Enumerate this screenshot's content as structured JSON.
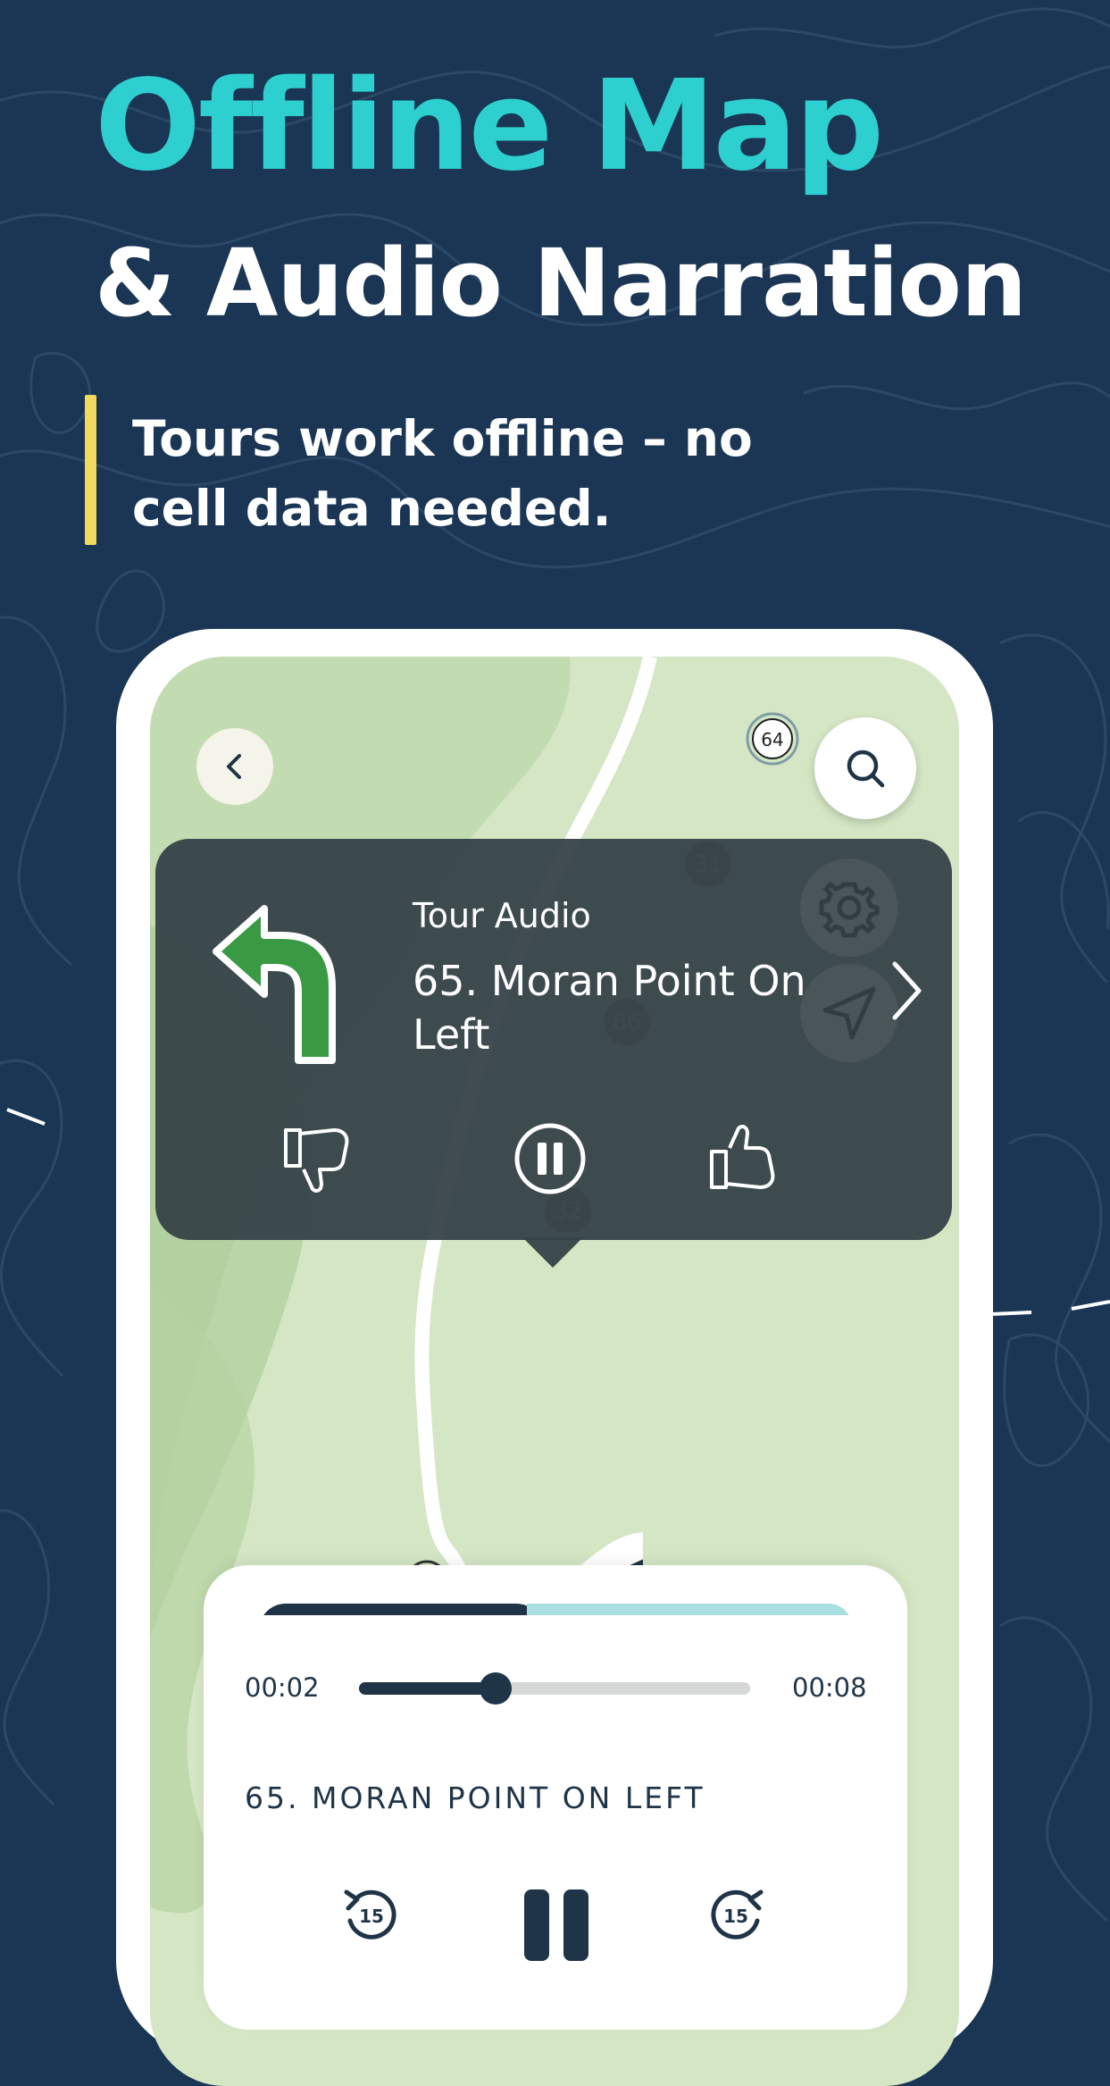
{
  "headline": {
    "line1": "Offline Map",
    "line2": "& Audio Narration",
    "subtitle": "Tours work offline – no cell data needed."
  },
  "colors": {
    "background": "#1a3654",
    "headline_accent": "#2ecfcf",
    "quote_bar": "#f2d95e",
    "turn_arrow": "#3a9a44",
    "stop_marker": "#d9622a",
    "player_dark": "#1f3447"
  },
  "map": {
    "markers": [
      "64",
      "31",
      "66",
      "32",
      "65"
    ],
    "active_marker": "65"
  },
  "popup": {
    "label": "Tour Audio",
    "title": "65. Moran Point On Left",
    "icons": [
      "turn-left-arrow-icon",
      "chevron-right-icon",
      "thumbs-down-icon",
      "pause-circle-icon",
      "thumbs-up-icon"
    ]
  },
  "map_controls": {
    "icons": [
      "chevron-left-icon",
      "search-icon",
      "gear-icon",
      "navigation-arrow-icon"
    ]
  },
  "player": {
    "elapsed": "00:02",
    "duration": "00:08",
    "progress": 0.35,
    "track_title": "65. MORAN POINT ON LEFT",
    "rewind_label": "15",
    "forward_label": "15",
    "icons": [
      "chevron-up-icon",
      "rewind-15-icon",
      "pause-icon",
      "forward-15-icon"
    ]
  }
}
